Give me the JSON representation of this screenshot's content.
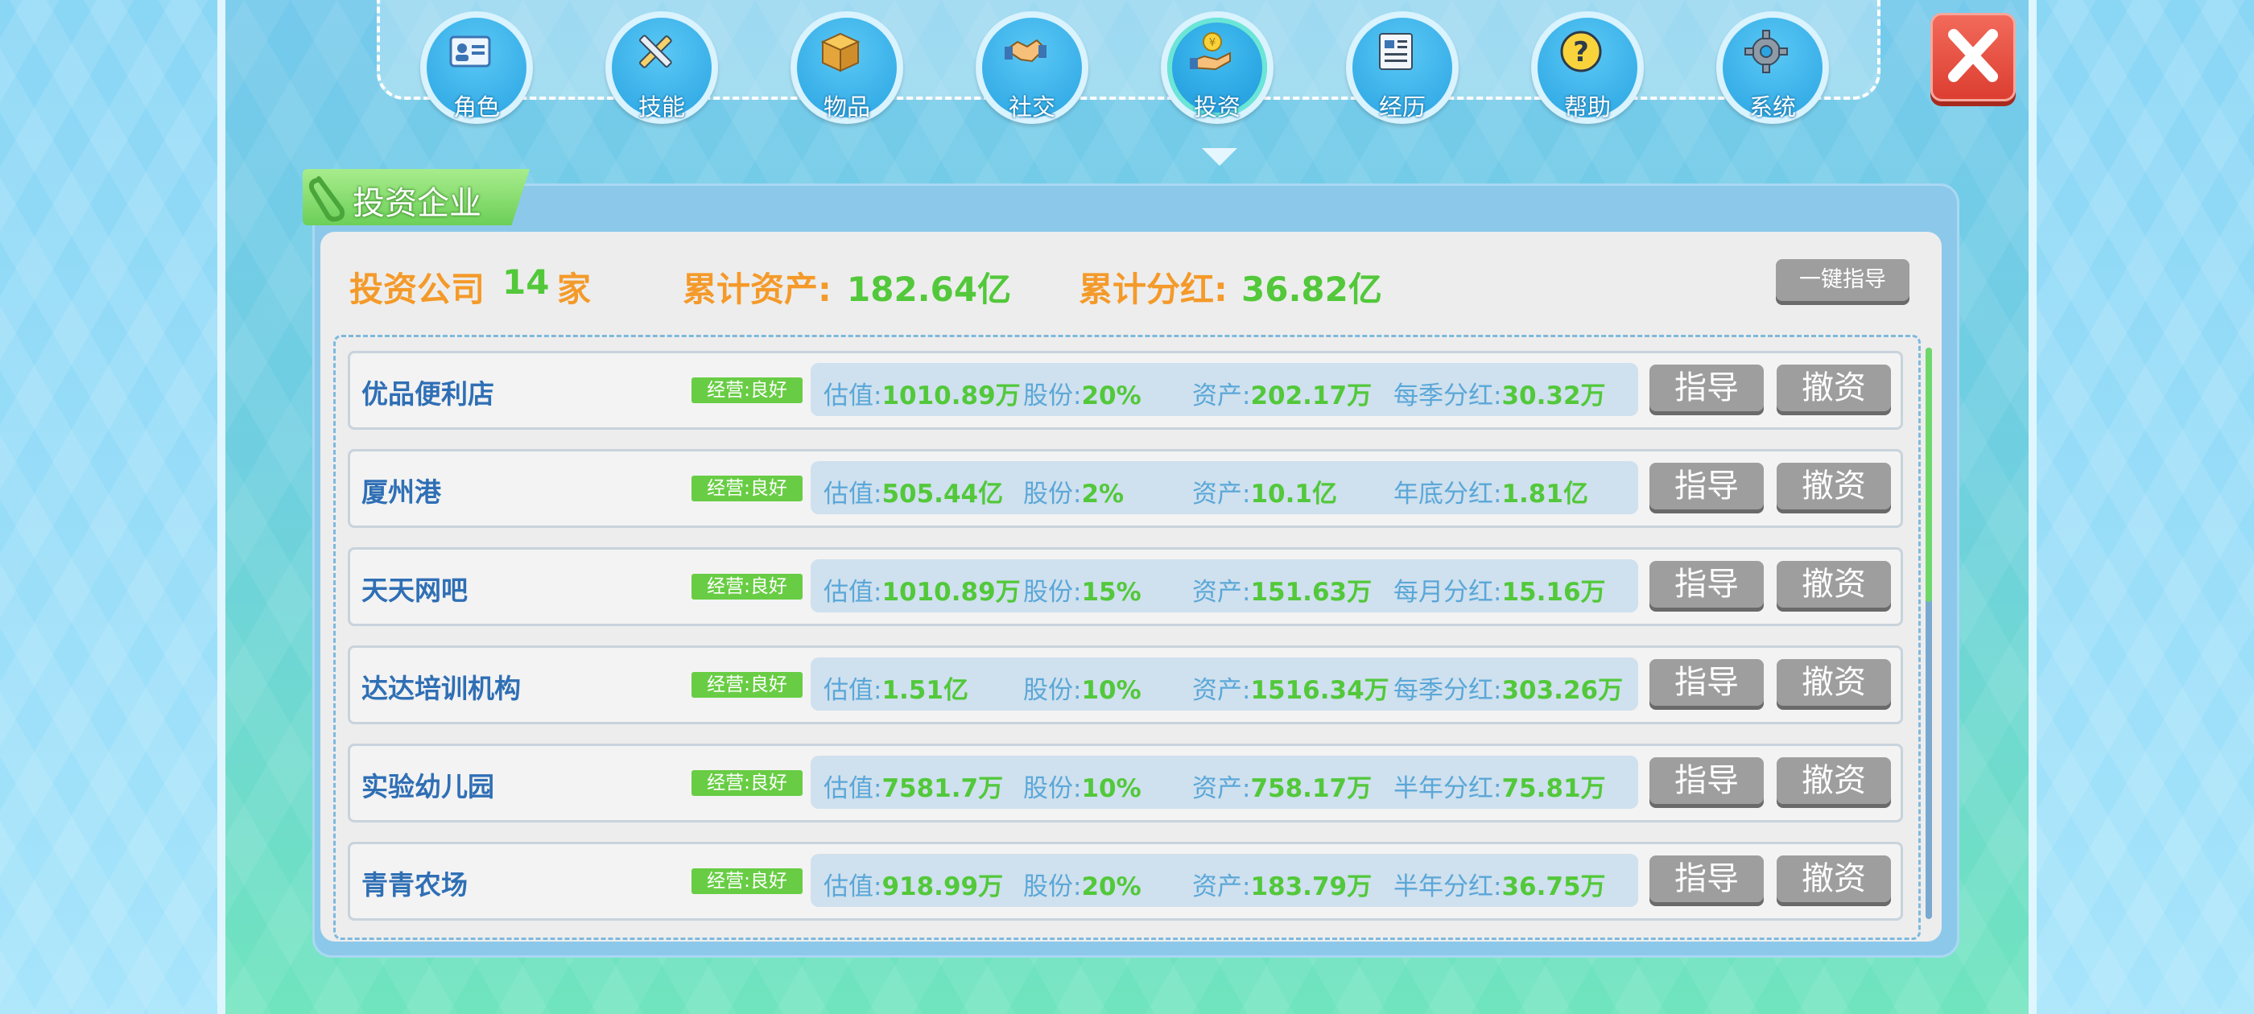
{
  "nav": {
    "items": [
      {
        "label": "角色",
        "icon": "id-card-icon"
      },
      {
        "label": "技能",
        "icon": "pencil-ruler-icon"
      },
      {
        "label": "物品",
        "icon": "box-icon"
      },
      {
        "label": "社交",
        "icon": "handshake-icon"
      },
      {
        "label": "投资",
        "icon": "coin-hand-icon",
        "active": true
      },
      {
        "label": "经历",
        "icon": "document-icon"
      },
      {
        "label": "帮助",
        "icon": "question-icon"
      },
      {
        "label": "系统",
        "icon": "gear-icon"
      }
    ]
  },
  "panel": {
    "title": "投资企业",
    "summary": {
      "companies_label": "投资公司",
      "companies_count": "14",
      "companies_unit": "家",
      "assets_label": "累计资产:",
      "assets_value": "182.64亿",
      "dividend_label": "累计分红:",
      "dividend_value": "36.82亿"
    },
    "guide_all_label": "一键指导",
    "valuation_label": "估值:",
    "shares_label": "股份:",
    "assets_label": "资产:",
    "guide_label": "指导",
    "withdraw_label": "撤资",
    "rows": [
      {
        "name": "优品便利店",
        "status": "经营:良好",
        "valuation": "1010.89万",
        "shares": "20%",
        "assets": "202.17万",
        "dividend_label": "每季分红:",
        "dividend": "30.32万"
      },
      {
        "name": "厦州港",
        "status": "经营:良好",
        "valuation": "505.44亿",
        "shares": "2%",
        "assets": "10.1亿",
        "dividend_label": "年底分红:",
        "dividend": "1.81亿"
      },
      {
        "name": "天天网吧",
        "status": "经营:良好",
        "valuation": "1010.89万",
        "shares": "15%",
        "assets": "151.63万",
        "dividend_label": "每月分红:",
        "dividend": "15.16万"
      },
      {
        "name": "达达培训机构",
        "status": "经营:良好",
        "valuation": "1.51亿",
        "shares": "10%",
        "assets": "1516.34万",
        "dividend_label": "每季分红:",
        "dividend": "303.26万"
      },
      {
        "name": "实验幼儿园",
        "status": "经营:良好",
        "valuation": "7581.7万",
        "shares": "10%",
        "assets": "758.17万",
        "dividend_label": "半年分红:",
        "dividend": "75.81万"
      },
      {
        "name": "青青农场",
        "status": "经营:良好",
        "valuation": "918.99万",
        "shares": "20%",
        "assets": "183.79万",
        "dividend_label": "半年分红:",
        "dividend": "36.75万"
      }
    ]
  },
  "colors": {
    "accent_green": "#52c83a",
    "accent_orange": "#f49a2a",
    "close_red": "#e04a3c"
  }
}
